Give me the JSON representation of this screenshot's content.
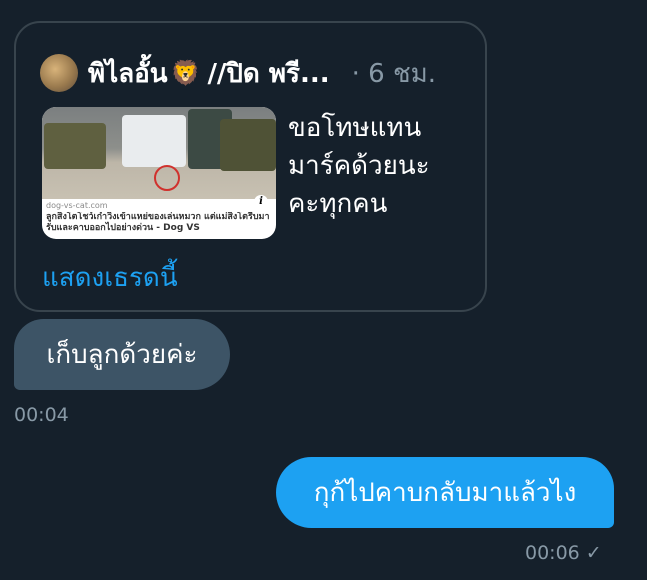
{
  "quoted_tweet": {
    "author_name": "พิไลอั้น",
    "emoji": "🦁",
    "name_suffix": "//ปิด พรี...",
    "time": "· 6 ชม.",
    "text_lines": [
      "ขอโทษแทน",
      "มาร์คด้วยนะ",
      "คะทุกคน"
    ],
    "link_card": {
      "domain": "dog-vs-cat.com",
      "title": "ลูกสิงโตโชว์เก๋าวิ่งเข้าแหย่ของเล่นหมวก แต่แม่สิงโตรีบมารับและคาบออกไปอย่างด่วน - Dog VS"
    },
    "show_thread": "แสดงเธรดนี้"
  },
  "messages": [
    {
      "direction": "incoming",
      "text": "เก็บลูกด้วยค่ะ",
      "time": "00:04"
    },
    {
      "direction": "outgoing",
      "text": "กุก้ไปคาบกลับมาแล้วไง",
      "time": "00:06",
      "status_icon": "✓"
    }
  ],
  "colors": {
    "background": "#15202b",
    "incoming_bubble": "#3d5466",
    "outgoing_bubble": "#1da1f2",
    "link": "#1da1f2",
    "muted": "#8899a6"
  }
}
